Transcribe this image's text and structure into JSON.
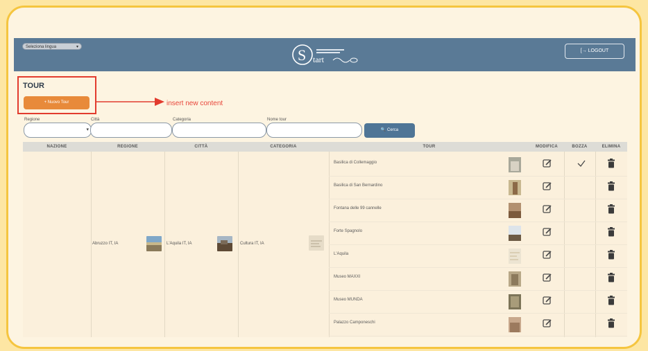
{
  "header": {
    "language_select": "Seleziona lingua",
    "logout_label": "[→ LOGOUT",
    "logo_text": "tart"
  },
  "page": {
    "title": "TOUR",
    "new_button": "+ Nuovo Tour",
    "annotation": "insert new content"
  },
  "filters": {
    "regione": "Regione",
    "citta": "Città",
    "categoria": "Categoria",
    "nome_tour": "Nome tour",
    "search_button": "🔍 Cerca"
  },
  "table": {
    "headers": [
      "NAZIONE",
      "REGIONE",
      "CITTÀ",
      "CATEGORIA",
      "TOUR",
      "MODIFICA",
      "BOZZA",
      "ELIMINA"
    ],
    "regione": "Abruzzo IT, IA",
    "citta": "L'Aquila IT, IA",
    "categoria": "Cultura IT, IA",
    "rows": [
      {
        "name": "Basilica di Collemaggio",
        "bozza": true
      },
      {
        "name": "Basilica di San Bernardino",
        "bozza": false
      },
      {
        "name": "Fontana delle 99 cannelle",
        "bozza": false
      },
      {
        "name": "Forte Spagnolo",
        "bozza": false
      },
      {
        "name": "L'Aquila",
        "bozza": false
      },
      {
        "name": "Museo MAXXI",
        "bozza": false
      },
      {
        "name": "Museo MUNDA",
        "bozza": false
      },
      {
        "name": "Palazzo Camponeschi",
        "bozza": false
      }
    ]
  },
  "colors": {
    "header_bg": "#5a7a96",
    "accent_orange": "#e88a3a",
    "annotation_red": "#e23b2e",
    "frame_yellow": "#f5c53f"
  }
}
